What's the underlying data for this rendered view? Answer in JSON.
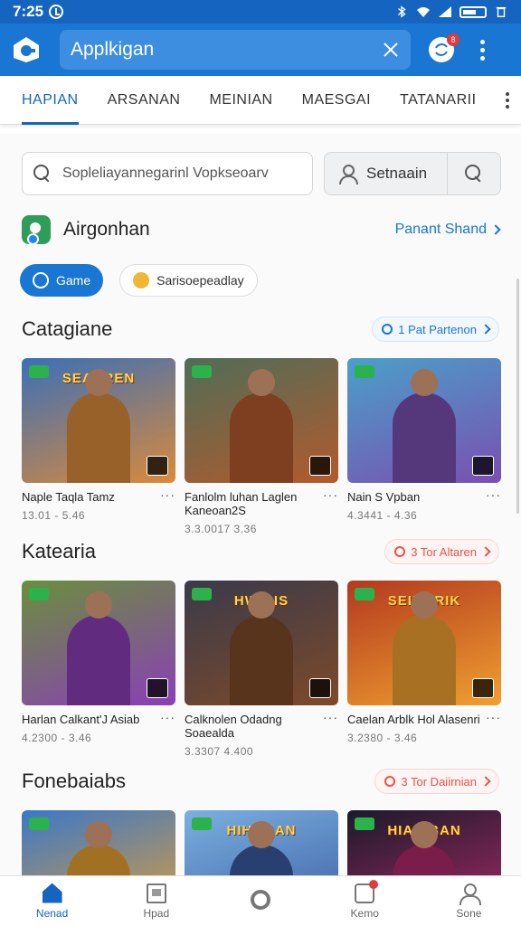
{
  "status_bar": {
    "time": "7:25"
  },
  "app_bar": {
    "search_value": "Applkigan",
    "badge": "8"
  },
  "tabs": [
    {
      "label": "HAPIAN",
      "active": true
    },
    {
      "label": "ARSANAN",
      "active": false
    },
    {
      "label": "MEINIAN",
      "active": false
    },
    {
      "label": "MAESGAI",
      "active": false
    },
    {
      "label": "TATANARII",
      "active": false
    }
  ],
  "search": {
    "placeholder": "Sopleliayannegarinl Vopkseoarv",
    "combo_label": "Setnaain"
  },
  "section": {
    "title": "Airgonhan",
    "link": "Panant Shand"
  },
  "chips": [
    {
      "label": "Game",
      "active": true
    },
    {
      "label": "Sarisoepeadlay",
      "active": false
    }
  ],
  "categories": [
    {
      "title": "Catagiane",
      "pill": "1 Pat Partenon",
      "pill_color": "blue",
      "cards": [
        {
          "title": "Naple Taqla Tamz",
          "sub": "13.01 - 5.46",
          "banner": "SEABREN",
          "colors": [
            "#3b6fb8",
            "#d98a3a"
          ]
        },
        {
          "title": "Fanlolm luhan Laglen Kaneoan2S",
          "sub": "3.3.0017 3.36",
          "banner": "",
          "colors": [
            "#4f6d58",
            "#b35a2c"
          ]
        },
        {
          "title": "Nain S Vpban",
          "sub": "4.3441 - 4.36",
          "banner": "",
          "colors": [
            "#4aa0c9",
            "#7a4fb0"
          ]
        }
      ]
    },
    {
      "title": "Katearia",
      "pill": "3 Tor Altaren",
      "pill_color": "red",
      "cards": [
        {
          "title": "Harlan Calkant'J Asiab",
          "sub": "4.2300 - 3.46",
          "banner": "",
          "colors": [
            "#6a8f3c",
            "#8a3fb6"
          ]
        },
        {
          "title": "Calknolen Odadng Soaealda",
          "sub": "3.3307 4.400",
          "banner": "HWIDIS",
          "colors": [
            "#3a3a4a",
            "#7d4a2a"
          ]
        },
        {
          "title": "Caelan Arblk Hol Alasenri",
          "sub": "3.2380 - 3.46",
          "banner": "SEINORIK",
          "colors": [
            "#b3391f",
            "#f0a030"
          ]
        }
      ]
    },
    {
      "title": "Fonebaiabs",
      "pill": "3 Tor Daiirnian",
      "pill_color": "red",
      "cards": [
        {
          "title": "",
          "sub": "",
          "banner": "",
          "colors": [
            "#3a78c8",
            "#e8a030"
          ]
        },
        {
          "title": "",
          "sub": "",
          "banner": "HIHUGAN",
          "colors": [
            "#7ab0e0",
            "#3a5aa0"
          ]
        },
        {
          "title": "",
          "sub": "",
          "banner": "HIANIBAN",
          "colors": [
            "#1a1a2a",
            "#b02a6a"
          ]
        }
      ]
    }
  ],
  "bottom_nav": [
    {
      "label": "Nenad",
      "icon": "home-icon",
      "active": true
    },
    {
      "label": "Hpad",
      "icon": "page-icon",
      "active": false
    },
    {
      "label": "",
      "icon": "ring-icon",
      "active": false
    },
    {
      "label": "Kemo",
      "icon": "chat-icon",
      "active": false
    },
    {
      "label": "Sone",
      "icon": "user-icon",
      "active": false
    }
  ]
}
